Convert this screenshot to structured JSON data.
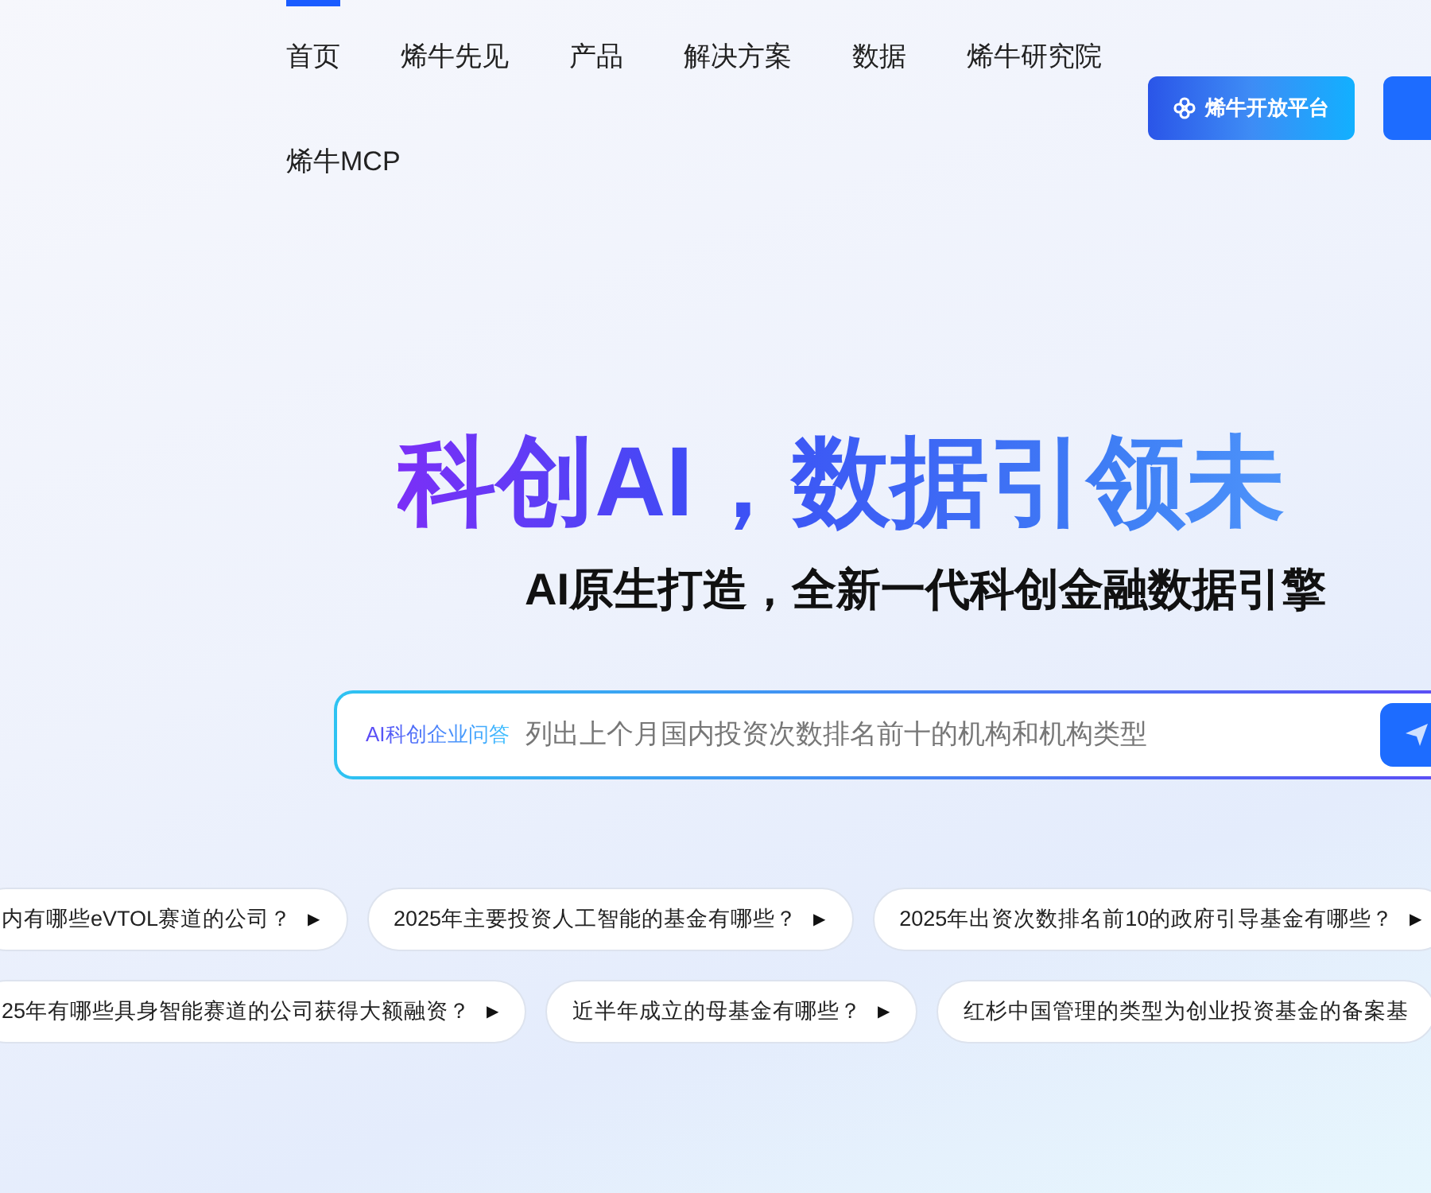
{
  "nav": {
    "items": [
      {
        "label": "首页",
        "selected": true
      },
      {
        "label": "烯牛先见",
        "selected": false
      },
      {
        "label": "产品",
        "selected": false
      },
      {
        "label": "解决方案",
        "selected": false
      },
      {
        "label": "数据",
        "selected": false
      },
      {
        "label": "烯牛研究院",
        "selected": false
      },
      {
        "label": "烯牛MCP",
        "selected": false
      }
    ],
    "platform_button": "烯牛开放平台"
  },
  "hero": {
    "title": "科创AI，数据引领未",
    "subtitle": "AI原生打造，全新一代科创金融数据引擎"
  },
  "search": {
    "mode_label": "AI科创企业问答",
    "placeholder": "列出上个月国内投资次数排名前十的机构和机构类型"
  },
  "suggestions": [
    [
      {
        "text": "内有哪些eVTOL赛道的公司？",
        "arrow": "▶"
      },
      {
        "text": "2025年主要投资人工智能的基金有哪些？",
        "arrow": "▶"
      },
      {
        "text": "2025年出资次数排名前10的政府引导基金有哪些？",
        "arrow": "▶"
      }
    ],
    [
      {
        "text": "25年有哪些具身智能赛道的公司获得大额融资？",
        "arrow": "▶"
      },
      {
        "text": "近半年成立的母基金有哪些？",
        "arrow": "▶"
      },
      {
        "text": "红杉中国管理的类型为创业投资基金的备案基"
      }
    ]
  ]
}
